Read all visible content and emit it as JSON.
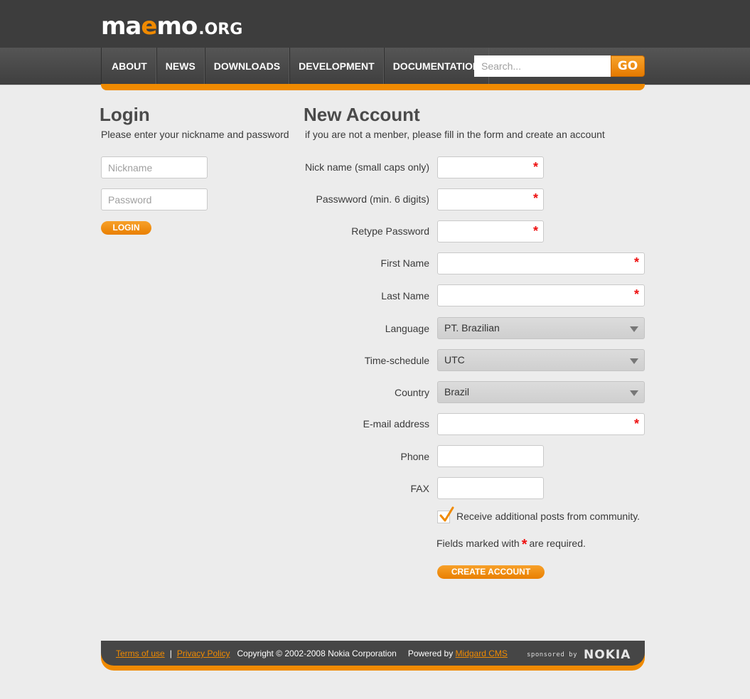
{
  "header": {
    "logo_main_a": "ma",
    "logo_main_e": "e",
    "logo_main_b": "mo",
    "logo_suffix": ".ORG",
    "nav": [
      "ABOUT",
      "NEWS",
      "DOWNLOADS",
      "DEVELOPMENT",
      "DOCUMENTATION"
    ],
    "search_placeholder": "Search...",
    "go_label": "GO"
  },
  "login": {
    "title": "Login",
    "subtitle": "Please enter your nickname and password",
    "nickname_placeholder": "Nickname",
    "password_placeholder": "Password",
    "button": "LOGIN"
  },
  "account": {
    "title": "New Account",
    "subtitle": "if you are not a menber, please fill in the form and create an account",
    "labels": {
      "nickname": "Nick name (small caps only)",
      "password": "Passwword (min. 6 digits)",
      "retype": "Retype Password",
      "first_name": "First Name",
      "last_name": "Last Name",
      "language": "Language",
      "timezone": "Time-schedule",
      "country": "Country",
      "email": "E-mail address",
      "phone": "Phone",
      "fax": "FAX"
    },
    "required_mark": "*",
    "language_value": "PT. Brazilian",
    "timezone_value": "UTC",
    "country_value": "Brazil",
    "checkbox_label": "Receive additional posts from community.",
    "checkbox_checked": true,
    "required_note_before": "Fields marked with",
    "required_note_after": "are required.",
    "button": "CREATE ACCOUNT"
  },
  "footer": {
    "terms": "Terms of use",
    "separator": "|",
    "privacy": "Privacy Policy",
    "copyright": "Copyright © 2002-2008 Nokia Corporation",
    "powered_by": "Powered by",
    "cms": "Midgard CMS",
    "sponsored_by": "sponsored by",
    "sponsor": "NOKIA"
  },
  "colors": {
    "accent": "#f08a00",
    "header_bg": "#3d3d3d",
    "page_bg": "#ececec",
    "required": "#e11111"
  }
}
